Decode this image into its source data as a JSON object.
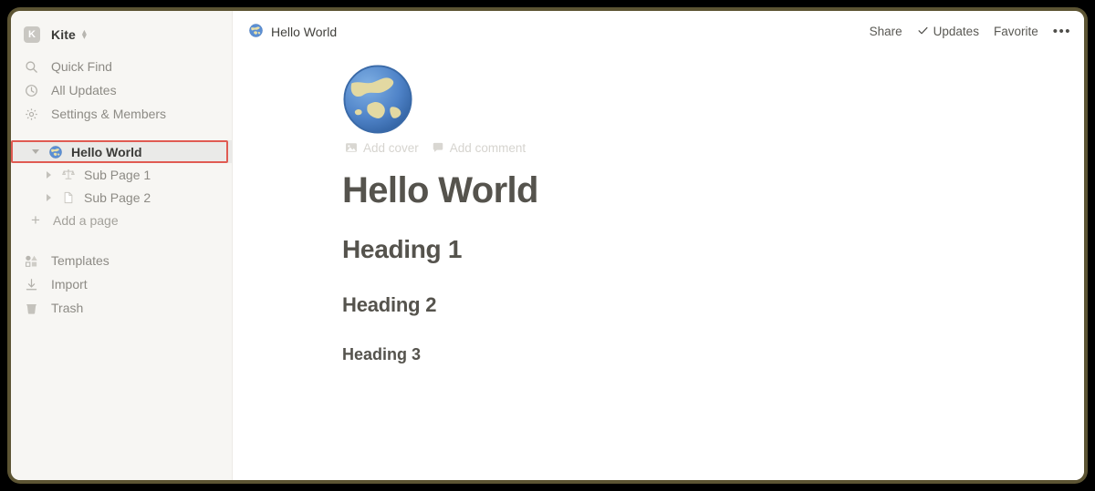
{
  "sidebar": {
    "workspace": {
      "avatar_letter": "K",
      "name": "Kite",
      "switcher_icon": "chevron-updown-icon"
    },
    "nav_top": [
      {
        "icon": "search-icon",
        "label": "Quick Find"
      },
      {
        "icon": "clock-icon",
        "label": "All Updates"
      },
      {
        "icon": "gear-icon",
        "label": "Settings & Members"
      }
    ],
    "tree": [
      {
        "label": "Hello World",
        "icon": "globe-emoji",
        "level": 1,
        "expanded": true,
        "selected": true
      },
      {
        "label": "Sub Page 1",
        "icon": "balance-scale-emoji",
        "level": 2,
        "expanded": false,
        "selected": false
      },
      {
        "label": "Sub Page 2",
        "icon": "page-icon",
        "level": 2,
        "expanded": false,
        "selected": false
      }
    ],
    "add_page": {
      "icon": "plus-icon",
      "label": "Add a page"
    },
    "nav_bottom": [
      {
        "icon": "templates-icon",
        "label": "Templates"
      },
      {
        "icon": "import-download-icon",
        "label": "Import"
      },
      {
        "icon": "trash-icon",
        "label": "Trash"
      }
    ]
  },
  "topbar": {
    "breadcrumb": {
      "icon": "globe-emoji",
      "label": "Hello World"
    },
    "share_label": "Share",
    "updates_label": "Updates",
    "updates_icon": "check-icon",
    "favorite_label": "Favorite",
    "more_icon": "ellipsis-icon"
  },
  "document": {
    "emoji": "globe-emoji",
    "add_cover_label": "Add cover",
    "add_cover_icon": "image-icon",
    "add_comment_label": "Add comment",
    "add_comment_icon": "comment-icon",
    "title": "Hello World",
    "blocks": [
      {
        "type": "heading1",
        "text": "Heading 1"
      },
      {
        "type": "heading2",
        "text": "Heading 2"
      },
      {
        "type": "heading3",
        "text": "Heading 3"
      }
    ]
  },
  "colors": {
    "sidebar_bg": "#f7f6f3",
    "selection_outline": "#e05b52",
    "selected_row_bg": "#eaeae8",
    "text_primary": "#3b3b38",
    "text_secondary": "#8d8b85",
    "heading_text": "#55534d",
    "window_frame": "#5c5433"
  }
}
